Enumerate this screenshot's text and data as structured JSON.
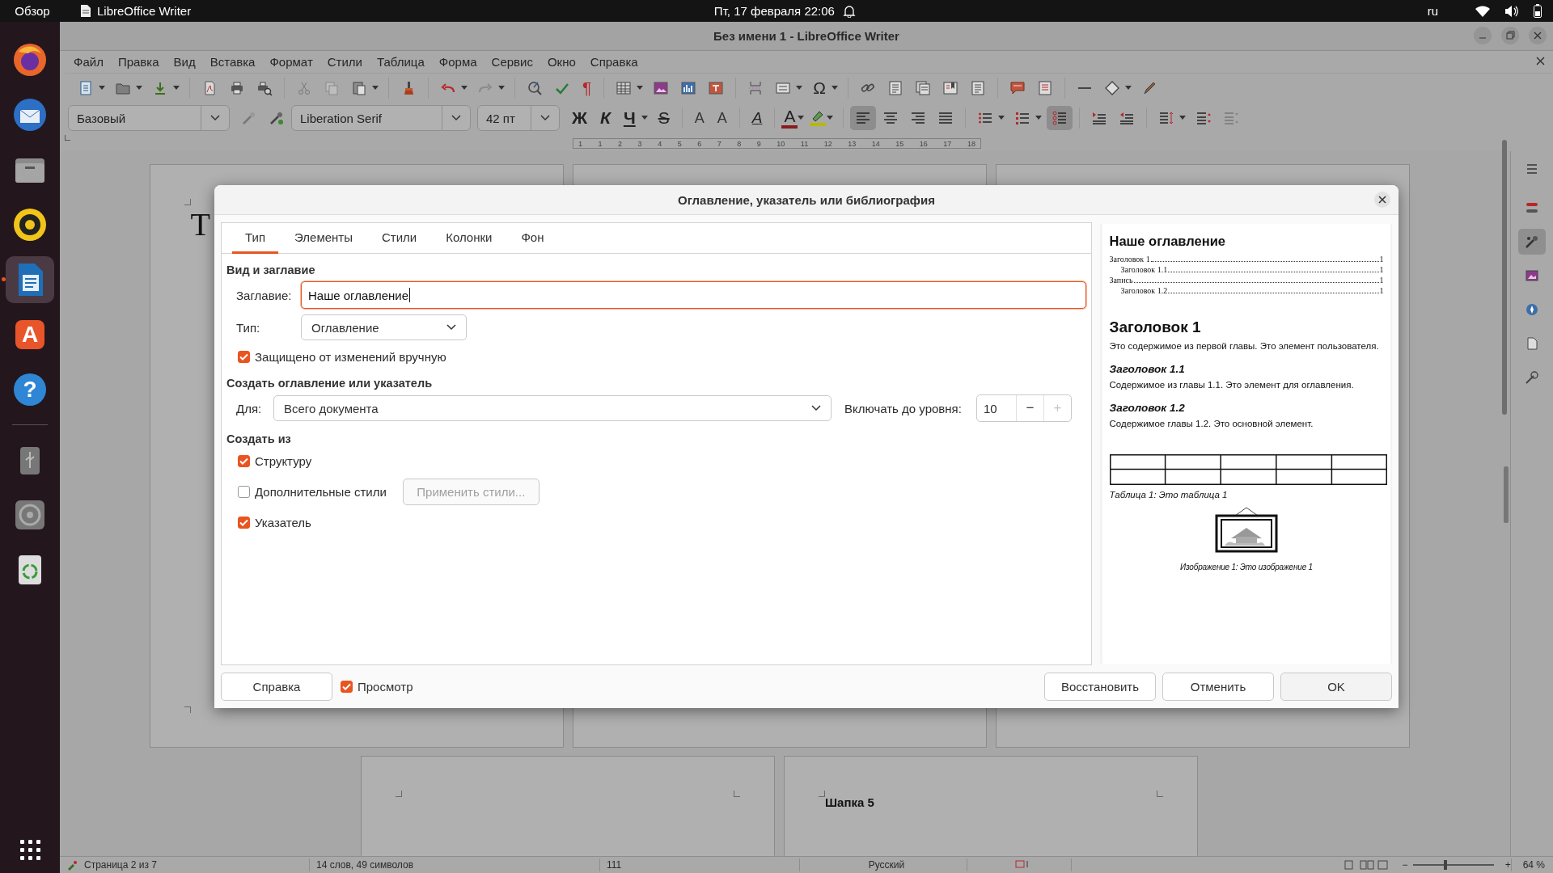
{
  "top_bar": {
    "activities": "Обзор",
    "app_name": "LibreOffice Writer",
    "clock": "Пт, 17 февраля  22:06",
    "keyboard_layout": "ru"
  },
  "dock": [
    {
      "kind": "browser",
      "selected": false
    },
    {
      "kind": "mail",
      "selected": false
    },
    {
      "kind": "files",
      "selected": false
    },
    {
      "kind": "music",
      "selected": false
    },
    {
      "kind": "writer",
      "selected": true
    },
    {
      "kind": "store",
      "selected": false,
      "glyph": "A"
    },
    {
      "kind": "help",
      "selected": false,
      "glyph": "?"
    },
    {
      "kind": "usb",
      "selected": false
    },
    {
      "kind": "disc",
      "selected": false
    },
    {
      "kind": "trash",
      "selected": false
    }
  ],
  "window": {
    "title": "Без имени 1 - LibreOffice Writer"
  },
  "menu": [
    "Файл",
    "Правка",
    "Вид",
    "Вставка",
    "Формат",
    "Стили",
    "Таблица",
    "Форма",
    "Сервис",
    "Окно",
    "Справка"
  ],
  "standard_toolbar": {
    "formatting_marks": "¶",
    "special_character": "Ω"
  },
  "formatting_toolbar": {
    "paragraph_style": "Базовый",
    "font_name": "Liberation Serif",
    "font_size": "42 пт",
    "bold": "Ж",
    "italic": "К",
    "underline": "Ч",
    "strikethrough": "S",
    "superscript": "A",
    "subscript": "A",
    "clear_formatting": "A",
    "font_color": "A",
    "alignment": [
      {
        "selected": true
      },
      {
        "selected": false
      },
      {
        "selected": false
      },
      {
        "selected": false
      }
    ],
    "outline_format": {
      "on": true
    }
  },
  "ruler": [
    "1",
    "1",
    "2",
    "3",
    "4",
    "5",
    "6",
    "7",
    "8",
    "9",
    "10",
    "11",
    "12",
    "13",
    "14",
    "15",
    "16",
    "17",
    "18"
  ],
  "document": {
    "title_fragment": "Т",
    "page_text": "Шапка 5"
  },
  "sidebar": [
    {
      "kind": "menu",
      "selected": false
    },
    {
      "kind": "properties",
      "selected": false
    },
    {
      "kind": "styles",
      "selected": true
    },
    {
      "kind": "gallery",
      "selected": false
    },
    {
      "kind": "navigator",
      "selected": false
    },
    {
      "kind": "page",
      "selected": false
    },
    {
      "kind": "inspector",
      "selected": false
    }
  ],
  "status_bar": {
    "page": "Страница 2 из 7",
    "words": "14 слов, 49 символов",
    "column_3": "111",
    "language": "Русский",
    "zoom_out": "−",
    "zoom_in": "+",
    "zoom": {
      "level": 0.4
    },
    "zoom_reading": "64 %"
  },
  "dialog": {
    "title": "Оглавление, указатель или библиография",
    "tabs": [
      {
        "label": "Тип",
        "selected": true
      },
      {
        "label": "Элементы",
        "selected": false
      },
      {
        "label": "Стили",
        "selected": false
      },
      {
        "label": "Колонки",
        "selected": false
      },
      {
        "label": "Фон",
        "selected": false
      }
    ],
    "type_and_title": {
      "heading": "Вид и заглавие",
      "title_label": "Заглавие:",
      "title_value": "Наше оглавление",
      "type_label": "Тип:",
      "type_value": "Оглавление",
      "protected": {
        "label": "Защищено от изменений вручную",
        "checked": true
      }
    },
    "create_index": {
      "heading": "Создать оглавление или указатель",
      "for_label": "Для:",
      "for_value": "Всего документа",
      "level_label": "Включать до уровня:",
      "level_value": "10",
      "decrement": "−",
      "increment": "+",
      "increment_disabled": true
    },
    "create_from": {
      "heading": "Создать из",
      "options": [
        {
          "label": "Структуру",
          "checked": true
        },
        {
          "label": "Дополнительные стили",
          "checked": false,
          "button": "Применить стили...",
          "button_disabled": true
        },
        {
          "label": "Указатель",
          "checked": true
        }
      ]
    },
    "preview": {
      "title": "Наше оглавление",
      "toc": [
        {
          "text": "Заголовок 1",
          "page": "1",
          "children": [
            {
              "text": "Заголовок 1.1",
              "page": "1"
            }
          ]
        },
        {
          "text": "Запись",
          "page": "1",
          "children": [
            {
              "text": "Заголовок 1.2",
              "page": "1"
            }
          ]
        }
      ],
      "heading": "Заголовок 1",
      "paragraph": "Это содержимое из первой главы. Это элемент пользователя.",
      "subsections": [
        {
          "heading": "Заголовок 1.1",
          "text": "Содержимое из главы 1.1. Это элемент для оглавления."
        },
        {
          "heading": "Заголовок 1.2",
          "text": "Содержимое главы 1.2. Это основной элемент."
        }
      ],
      "table_caption": "Таблица 1: Это таблица 1",
      "image_caption": "Изображение 1: Это изображение 1"
    },
    "buttons": {
      "help": "Справка",
      "preview_toggle": {
        "label": "Просмотр",
        "checked": true
      },
      "reset": "Восстановить",
      "cancel": "Отменить",
      "ok": "OK"
    }
  }
}
